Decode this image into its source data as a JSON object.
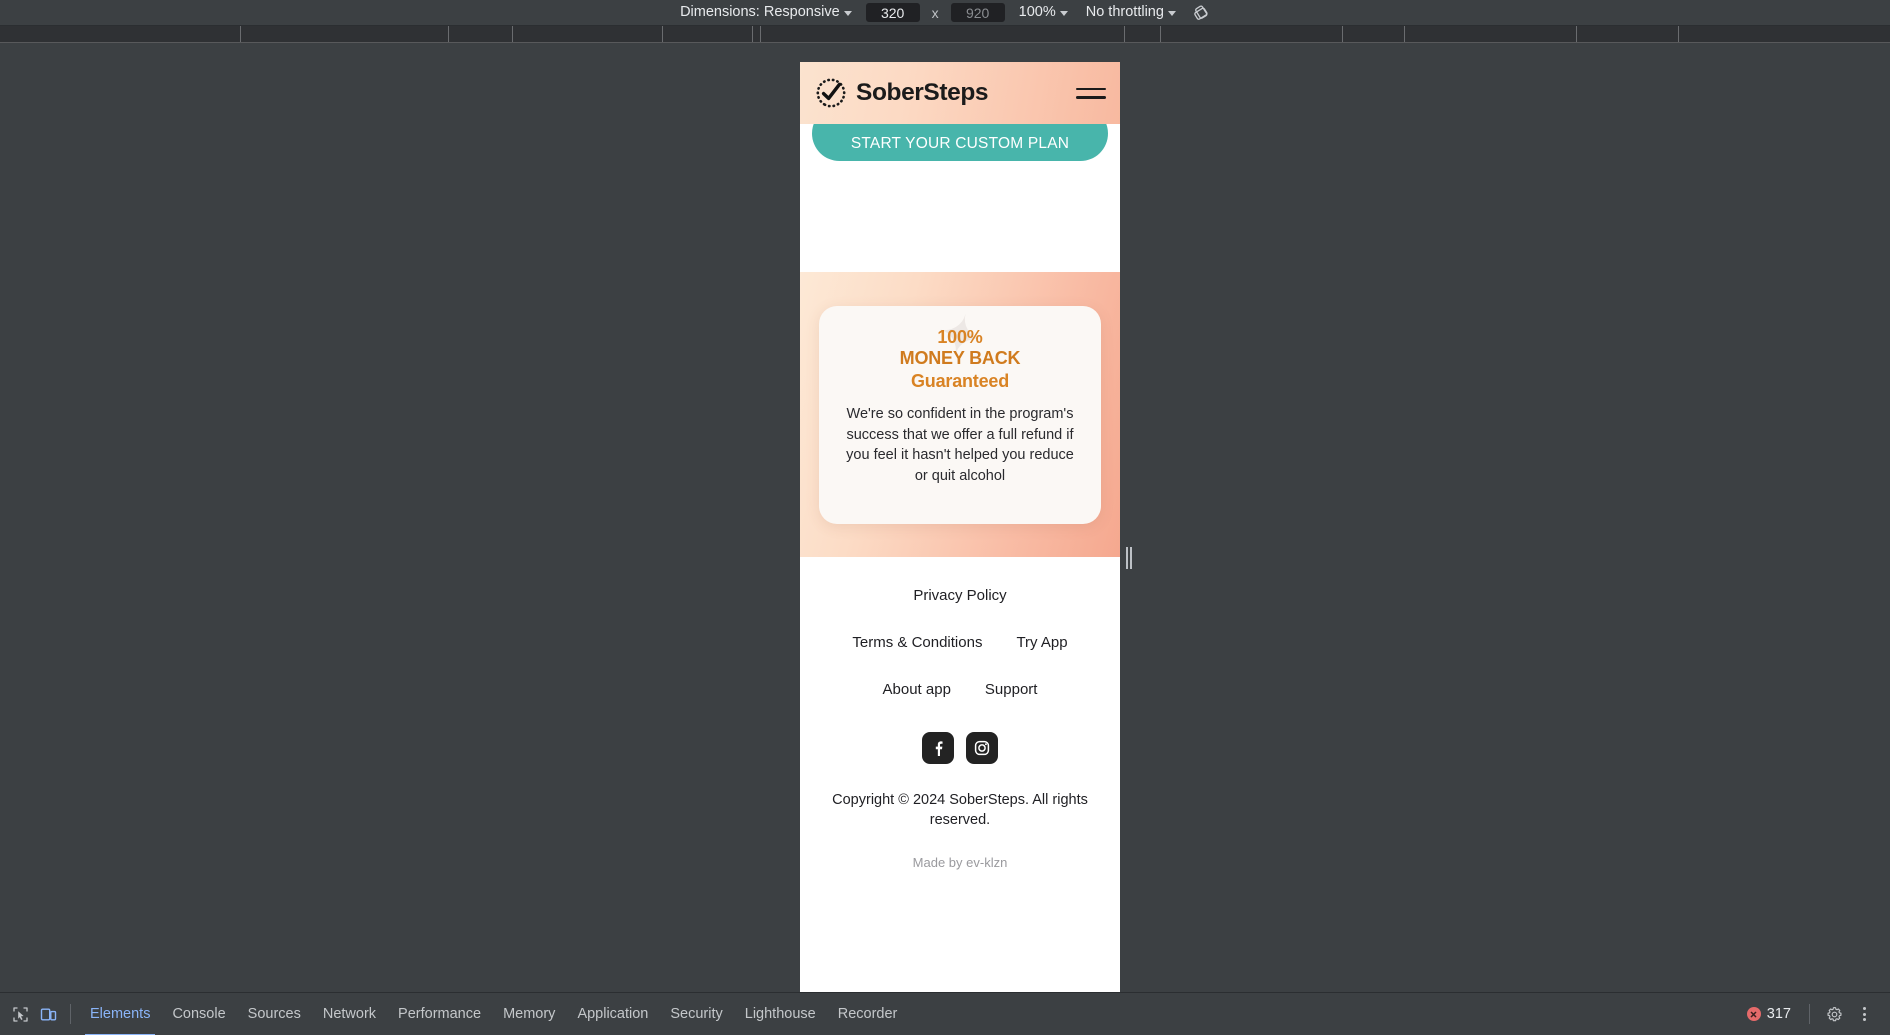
{
  "device_toolbar": {
    "dimensions_label": "Dimensions: Responsive",
    "width_value": "320",
    "height_value": "920",
    "multiply_symbol": "x",
    "zoom_label": "100%",
    "throttling_label": "No throttling",
    "rotate_icon": "rotate-device-icon",
    "dimensions_caret_icon": "chevron-down-icon",
    "zoom_caret_icon": "chevron-down-icon",
    "throttling_caret_icon": "chevron-down-icon"
  },
  "page": {
    "header": {
      "brand": "SoberSteps",
      "logo_icon": "check-circle-dotted-icon",
      "menu_icon": "hamburger-menu-icon"
    },
    "cta": {
      "label": "START YOUR CUSTOM PLAN",
      "color": "#48b5ab"
    },
    "guarantee": {
      "watermark": "✦",
      "line1": "100%",
      "line2": "MONEY BACK",
      "line3": "Guaranteed",
      "body": "We're so confident in the program's success that we offer a full refund if you feel it hasn't helped you reduce or quit alcohol",
      "accent_color": "#d98324"
    },
    "footer": {
      "privacy_policy": "Privacy Policy",
      "terms": "Terms & Conditions",
      "try_app": "Try App",
      "about_app": "About app",
      "support": "Support",
      "facebook_icon": "facebook-icon",
      "instagram_icon": "instagram-icon",
      "copyright": "Copyright © 2024 SoberSteps. All rights reserved.",
      "made_by": "Made by ev-klzn"
    }
  },
  "devtools": {
    "inspect_icon": "inspect-element-icon",
    "device_toggle_icon": "device-toolbar-icon",
    "tabs": [
      {
        "label": "Elements",
        "selected": true
      },
      {
        "label": "Console",
        "selected": false
      },
      {
        "label": "Sources",
        "selected": false
      },
      {
        "label": "Network",
        "selected": false
      },
      {
        "label": "Performance",
        "selected": false
      },
      {
        "label": "Memory",
        "selected": false
      },
      {
        "label": "Application",
        "selected": false
      },
      {
        "label": "Security",
        "selected": false
      },
      {
        "label": "Lighthouse",
        "selected": false
      },
      {
        "label": "Recorder",
        "selected": false
      }
    ],
    "error_count": "317",
    "error_icon": "error-circle-icon",
    "settings_icon": "gear-icon",
    "more_icon": "kebab-menu-icon"
  }
}
